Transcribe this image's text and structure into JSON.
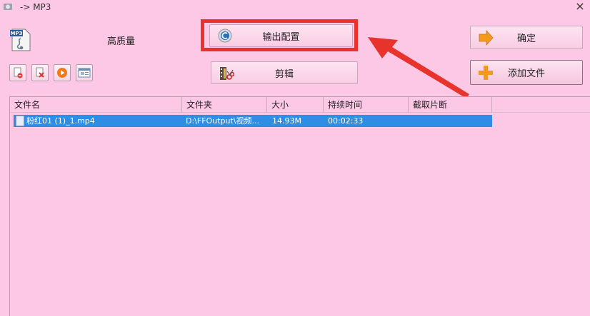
{
  "window": {
    "title": "-> MP3",
    "close_glyph": "×"
  },
  "format": {
    "quality_label": "高质量",
    "icon_text": "MP3"
  },
  "toolbar": {
    "output_config_label": "输出配置",
    "edit_label": "剪辑",
    "confirm_label": "确定",
    "add_file_label": "添加文件",
    "small_buttons": [
      "remove-icon",
      "clear-icon",
      "play-icon",
      "info-icon"
    ]
  },
  "table": {
    "columns": [
      "文件名",
      "文件夹",
      "大小",
      "持续时间",
      "截取片断"
    ],
    "rows": [
      {
        "name": "粉红01 (1)_1.mp4",
        "folder": "D:\\FFOutput\\视频...",
        "size": "14.93M",
        "duration": "00:02:33",
        "clip": ""
      }
    ]
  },
  "colors": {
    "background": "#fdc8e6",
    "highlight": "#e8322c",
    "selected_row": "#2f8ee3"
  }
}
